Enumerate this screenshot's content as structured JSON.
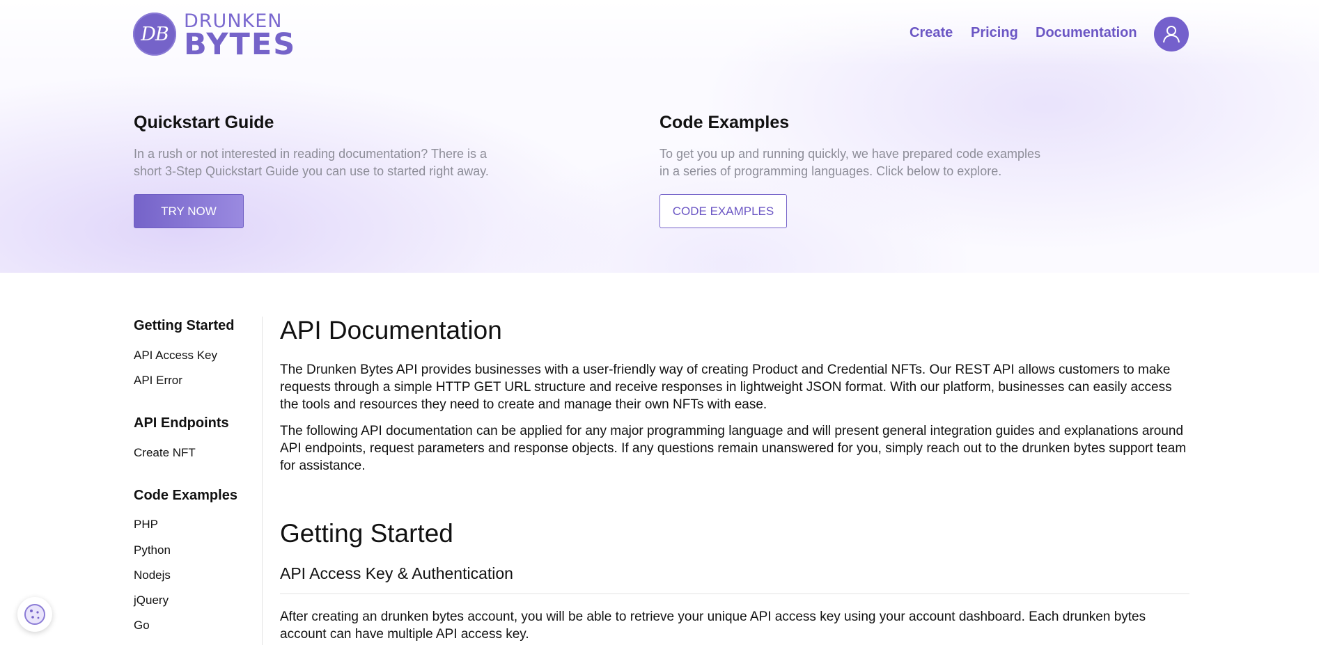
{
  "brand": {
    "monogram": "DB",
    "word1": "DRUNKEN",
    "word2": "BYTES"
  },
  "nav": {
    "create": "Create",
    "pricing": "Pricing",
    "documentation": "Documentation"
  },
  "hero": {
    "quickstart": {
      "title": "Quickstart Guide",
      "line1": "In a rush or not interested in reading documentation? There is a",
      "line2": "short 3-Step Quickstart Guide you can use to started right away.",
      "button": "TRY NOW"
    },
    "examples": {
      "title": "Code Examples",
      "line1": "To get you up and running quickly, we have prepared code examples",
      "line2": "in a series of programming languages. Click below to explore.",
      "button": "CODE EXAMPLES"
    }
  },
  "sidebar": {
    "sections": [
      {
        "heading": "Getting Started",
        "items": [
          "API Access Key",
          "API Error"
        ]
      },
      {
        "heading": "API Endpoints",
        "items": [
          "Create NFT"
        ]
      },
      {
        "heading": "Code Examples",
        "items": [
          "PHP",
          "Python",
          "Nodejs",
          "jQuery",
          "Go"
        ]
      }
    ]
  },
  "main": {
    "title": "API Documentation",
    "intro1": "The Drunken Bytes API provides businesses with a user-friendly way of creating Product and Credential NFTs. Our REST API allows customers to make requests through a simple HTTP GET URL structure and receive responses in lightweight JSON format. With our platform, businesses can easily access the tools and resources they need to create and manage their own NFTs with ease.",
    "intro2": "The following API documentation can be applied for any major programming language and will present general integration guides and explanations around API endpoints, request parameters and response objects. If any questions remain unanswered for you, simply reach out to the drunken bytes support team for assistance.",
    "getting_started": "Getting Started",
    "access_key_heading": "API Access Key & Authentication",
    "access_key_text": "After creating an drunken bytes account, you will be able to retrieve your unique API access key using your account dashboard. Each drunken bytes account can have multiple API access key."
  },
  "colors": {
    "accent": "#7563c9",
    "nav_text": "#6b56c4",
    "muted": "#8d8d98"
  },
  "icons": {
    "avatar": "user-icon",
    "cookie": "cookie-icon"
  }
}
